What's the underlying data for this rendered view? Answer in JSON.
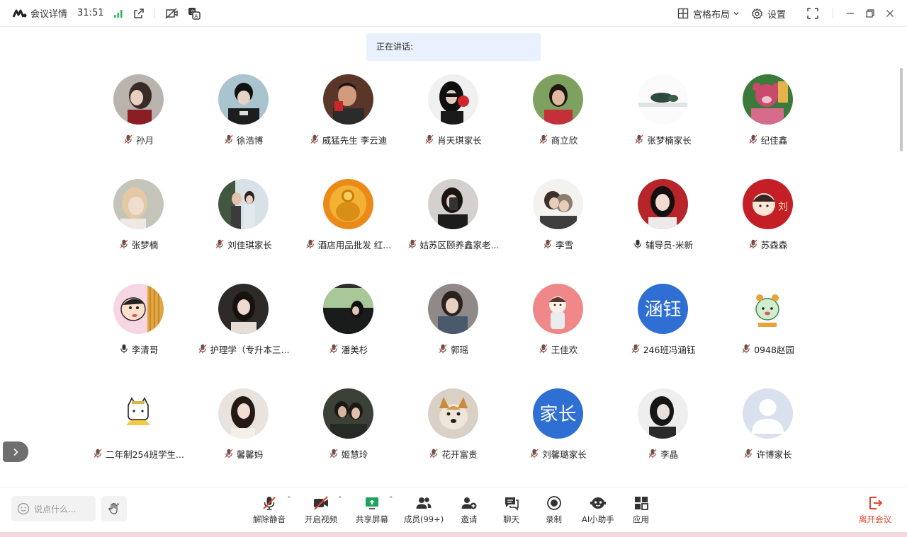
{
  "titlebar": {
    "app_title": "会议详情",
    "timer": "31:51",
    "layout_label": "宫格布局",
    "settings_label": "设置"
  },
  "speaking_label": "正在讲话:",
  "participants": [
    {
      "name": "孙月",
      "muted": true,
      "avatar": "photo-girl"
    },
    {
      "name": "徐浩博",
      "muted": true,
      "avatar": "photo-boy"
    },
    {
      "name": "威猛先生 李云迪",
      "muted": true,
      "avatar": "photo-man-red"
    },
    {
      "name": "肖天琪家长",
      "muted": true,
      "avatar": "photo-girl-flower"
    },
    {
      "name": "商立欣",
      "muted": true,
      "avatar": "photo-woman-outdoor"
    },
    {
      "name": "张梦楠家长",
      "muted": true,
      "avatar": "photo-landscape"
    },
    {
      "name": "纪佳鑫",
      "muted": true,
      "avatar": "photo-bear"
    },
    {
      "name": "张梦楠",
      "muted": true,
      "avatar": "photo-blonde"
    },
    {
      "name": "刘佳琪家长",
      "muted": true,
      "avatar": "photo-couple"
    },
    {
      "name": "酒店用品批发 红...",
      "muted": true,
      "avatar": "photo-buddha"
    },
    {
      "name": "姑苏区颐养鑫家老...",
      "muted": true,
      "avatar": "photo-selfie"
    },
    {
      "name": "李雪",
      "muted": true,
      "avatar": "photo-kids"
    },
    {
      "name": "辅导员-米新",
      "muted": false,
      "avatar": "photo-woman-red"
    },
    {
      "name": "苏森森",
      "muted": true,
      "avatar": "photo-cartoon-red"
    },
    {
      "name": "李清哥",
      "muted": false,
      "avatar": "photo-crayon"
    },
    {
      "name": "护理学（专升本三...",
      "muted": true,
      "avatar": "photo-woman-dark"
    },
    {
      "name": "潘美杉",
      "muted": true,
      "avatar": "photo-car"
    },
    {
      "name": "郭瑶",
      "muted": true,
      "avatar": "photo-woman-phone"
    },
    {
      "name": "王佳欢",
      "muted": true,
      "avatar": "photo-cartoon-pink"
    },
    {
      "name": "246班冯涵钰",
      "muted": true,
      "avatar": "text",
      "avatar_text": "涵钰"
    },
    {
      "name": "0948赵园",
      "muted": true,
      "avatar": "photo-cartoon-green"
    },
    {
      "name": "二年制254班学生...",
      "muted": true,
      "avatar": "photo-cat"
    },
    {
      "name": "馨馨妈",
      "muted": true,
      "avatar": "photo-woman-long"
    },
    {
      "name": "姬慧玲",
      "muted": true,
      "avatar": "photo-couple-dark"
    },
    {
      "name": "花开富贵",
      "muted": true,
      "avatar": "photo-dog"
    },
    {
      "name": "刘馨璐家长",
      "muted": true,
      "avatar": "text",
      "avatar_text": "家长"
    },
    {
      "name": "李晶",
      "muted": true,
      "avatar": "photo-woman-bw"
    },
    {
      "name": "许博家长",
      "muted": true,
      "avatar": "default-person"
    }
  ],
  "toolbar": {
    "chat_placeholder": "说点什么...",
    "unmute": "解除静音",
    "start_video": "开启视频",
    "share_screen": "共享屏幕",
    "members": "成员(99+)",
    "invite": "邀请",
    "chat": "聊天",
    "record": "录制",
    "ai_assistant": "AI小助手",
    "apps": "应用",
    "leave": "离开会议"
  },
  "colors": {
    "accent_blue": "#2f6fd3",
    "leave_red": "#e4442f",
    "signal_green": "#2db55d",
    "speaking_bg": "#e8f1fd"
  }
}
